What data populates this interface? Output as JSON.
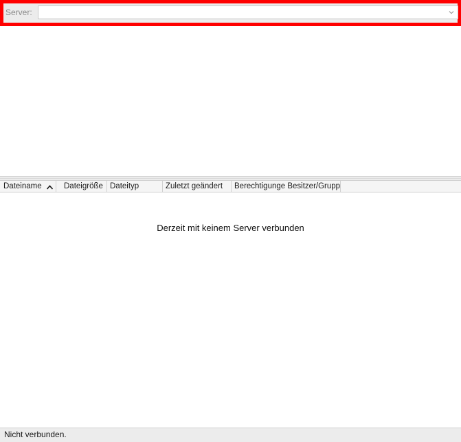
{
  "server_bar": {
    "label": "Server:",
    "combo_value": "",
    "combo_icon": "chevron-down-icon",
    "highlight_color": "#ff0000"
  },
  "file_list": {
    "columns": [
      {
        "label": "Dateiname",
        "sort_icon": "chevron-up-icon"
      },
      {
        "label": "Dateigröße"
      },
      {
        "label": "Dateityp"
      },
      {
        "label": "Zuletzt geändert"
      },
      {
        "label": "Berechtigunge Besitzer/Grupp"
      }
    ],
    "empty_message": "Derzeit mit keinem Server verbunden"
  },
  "status_bar": {
    "text": "Nicht verbunden."
  }
}
